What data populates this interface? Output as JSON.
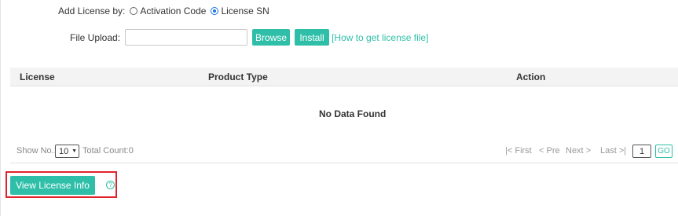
{
  "add_license": {
    "label": "Add License by:",
    "options": [
      {
        "label": "Activation Code",
        "selected": false
      },
      {
        "label": "License SN",
        "selected": true
      }
    ]
  },
  "upload": {
    "label": "File Upload:",
    "value": "",
    "browse_label": "Browse",
    "install_label": "Install",
    "help_link": "[How to get license file]"
  },
  "table": {
    "columns": [
      "License",
      "Product Type",
      "Action"
    ],
    "empty_text": "No Data Found"
  },
  "pagination": {
    "show_label": "Show No.:",
    "page_size": "10",
    "total_label": "Total Count:0",
    "first": "First",
    "prev": "Pre",
    "next": "Next",
    "last": "Last",
    "page_value": "1",
    "go_label": "GO"
  },
  "actions": {
    "view_license_info": "View License Info",
    "help_icon": "question-circle-icon"
  },
  "colors": {
    "accent": "#2fbfa9",
    "highlight": "#e0232b",
    "radio": "#1a73e8"
  }
}
